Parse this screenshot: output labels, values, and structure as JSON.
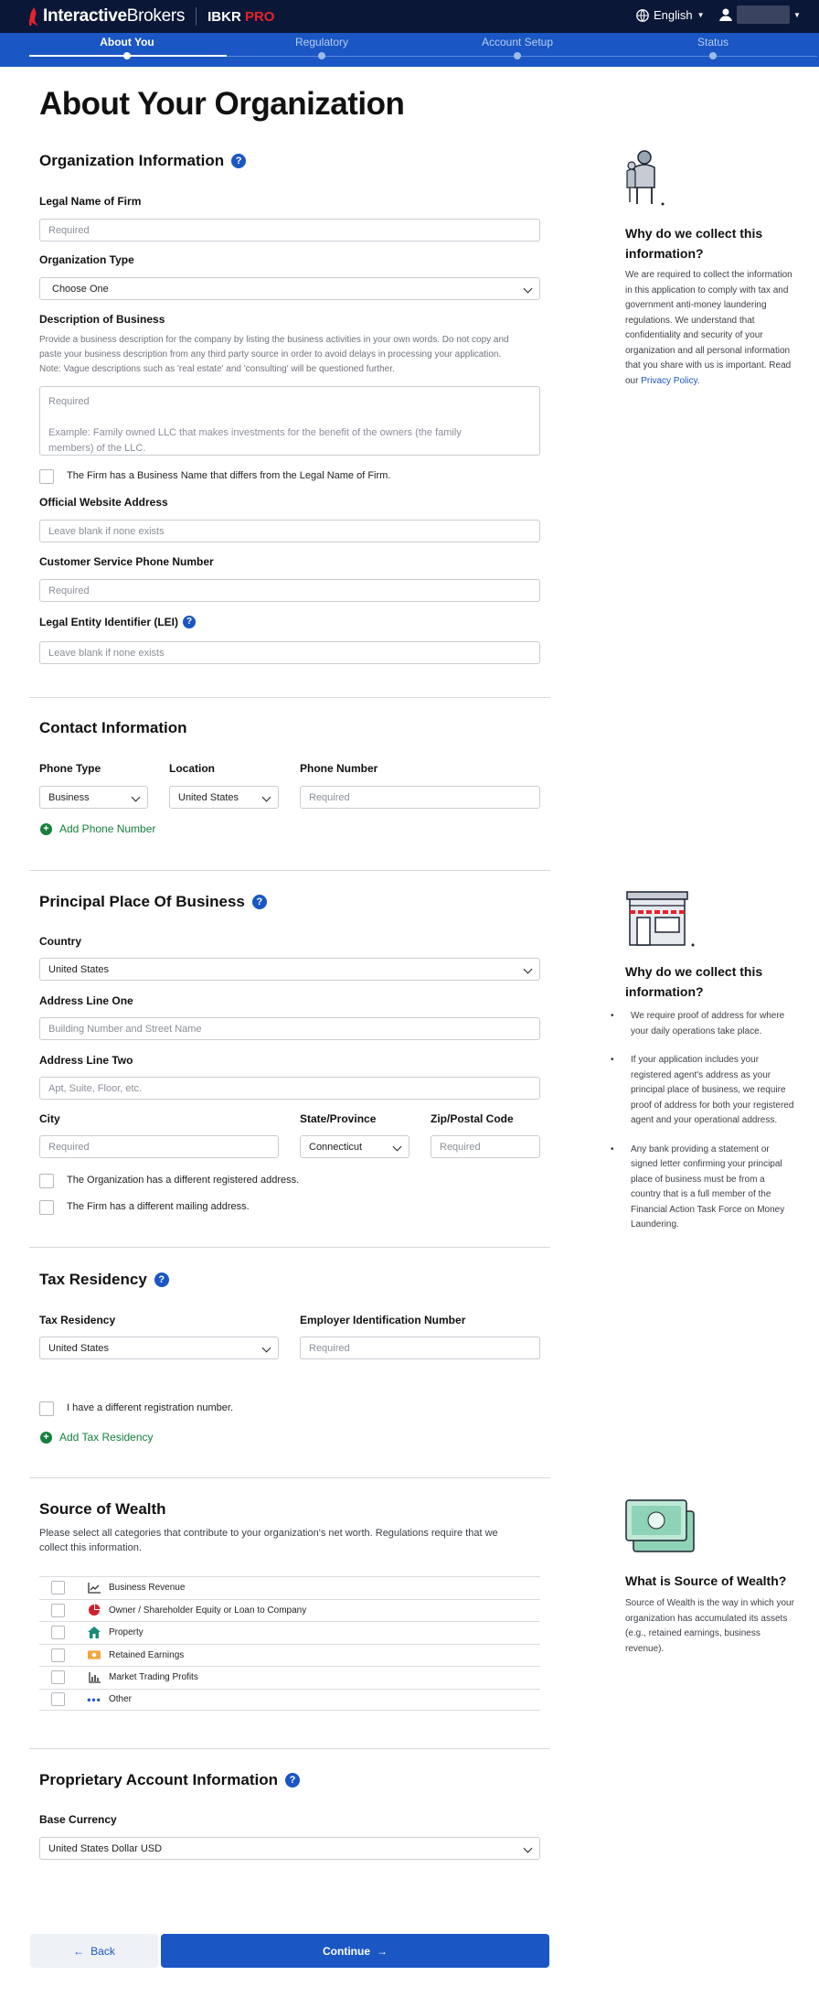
{
  "header": {
    "brand": "InteractiveBrokers",
    "brand_bold": "Interactive",
    "brand_light": "Brokers",
    "product_prefix": "IBKR",
    "product_suffix": "PRO",
    "language": "English",
    "colors": {
      "topbar": "#0b1736",
      "progress": "#1a56c4",
      "accent_red": "#e4232d"
    }
  },
  "steps": [
    {
      "label": "About You",
      "active": true
    },
    {
      "label": "Regulatory",
      "active": false
    },
    {
      "label": "Account Setup",
      "active": false
    },
    {
      "label": "Status",
      "active": false
    }
  ],
  "page_title": "About Your Organization",
  "org_info": {
    "title": "Organization Information",
    "legal_name_label": "Legal Name of Firm",
    "legal_name_placeholder": "Required",
    "org_type_label": "Organization Type",
    "org_type_value": "Choose One",
    "desc_label": "Description of Business",
    "desc_hint_1": "Provide a business description for the company by listing the business activities in your own words. Do not copy and",
    "desc_hint_2": "paste your business description from any third party source in order to avoid delays in processing your application.",
    "desc_hint_3": "Note: Vague descriptions such as 'real estate' and 'consulting' will be questioned further.",
    "desc_placeholder_1": "Required",
    "desc_placeholder_2": "Example: Family owned LLC that makes investments for the benefit of the owners (the family",
    "desc_placeholder_3": "members) of the LLC.",
    "business_name_check": "The Firm has a Business Name that differs from the Legal Name of Firm.",
    "website_label": "Official Website Address",
    "website_placeholder": "Leave blank if none exists",
    "phone_label": "Customer Service Phone Number",
    "phone_placeholder": "Required",
    "lei_label": "Legal Entity Identifier (LEI)",
    "lei_placeholder": "Leave blank if none exists"
  },
  "why_collect": {
    "title_1": "Why do we collect this",
    "title_2": "information?",
    "text_1": "We are required to collect the information",
    "text_2": "in this application to comply with tax and",
    "text_3": "government anti-money laundering",
    "text_4": "regulations. We understand that",
    "text_5": "confidentiality and security of your",
    "text_6": "organization and all personal information",
    "text_7": "that you share with us is important. Read",
    "text_8": "our",
    "privacy_link": "Privacy Policy",
    "text_9": "."
  },
  "contact": {
    "title": "Contact Information",
    "phone_type_label": "Phone Type",
    "phone_type_value": "Business",
    "location_label": "Location",
    "location_value": "United States",
    "phone_number_label": "Phone Number",
    "phone_number_placeholder": "Required",
    "add_phone": "Add Phone Number"
  },
  "principal": {
    "title": "Principal Place Of Business",
    "country_label": "Country",
    "country_value": "United States",
    "addr1_label": "Address Line One",
    "addr1_placeholder": "Building Number and Street Name",
    "addr2_label": "Address Line Two",
    "addr2_placeholder": "Apt, Suite, Floor, etc.",
    "city_label": "City",
    "city_placeholder": "Required",
    "state_label": "State/Province",
    "state_value": "Connecticut",
    "zip_label": "Zip/Postal Code",
    "zip_placeholder": "Required",
    "registered_check": "The Organization has a different registered address.",
    "mailing_check": "The Firm has a different mailing address."
  },
  "why_collect_2": {
    "title_1": "Why do we collect this",
    "title_2": "information?",
    "bullet_1": [
      "We require proof of address for where",
      "your daily operations take place."
    ],
    "bullet_2": [
      "If your application includes your",
      "registered agent's address as your",
      "principal place of business, we require",
      "proof of address for both your registered",
      "agent and your operational address."
    ],
    "bullet_3": [
      "Any bank providing a statement or",
      "signed letter confirming your principal",
      "place of business must be from a",
      "country that is a full member of the",
      "Financial Action Task Force on Money",
      "Laundering."
    ]
  },
  "tax": {
    "title": "Tax Residency",
    "residency_label": "Tax Residency",
    "residency_value": "United States",
    "ein_label": "Employer Identification Number",
    "ein_placeholder": "Required",
    "diff_reg_check": "I have a different registration number.",
    "add_tax": "Add Tax Residency"
  },
  "sow": {
    "title": "Source of Wealth",
    "desc_1": "Please select all categories that contribute to your organization's net worth. Regulations require that we",
    "desc_2": "collect this information.",
    "items": [
      {
        "label": "Business Revenue",
        "icon": "line-chart-icon"
      },
      {
        "label": "Owner / Shareholder Equity or Loan to Company",
        "icon": "pie-chart-icon"
      },
      {
        "label": "Property",
        "icon": "house-icon"
      },
      {
        "label": "Retained Earnings",
        "icon": "cash-icon"
      },
      {
        "label": "Market Trading Profits",
        "icon": "bar-chart-icon"
      },
      {
        "label": "Other",
        "icon": "more-dots-icon"
      }
    ]
  },
  "sow_side": {
    "title": "What is Source of Wealth?",
    "text_1": "Source of Wealth is the way in which your",
    "text_2": "organization has accumulated its assets",
    "text_3": "(e.g., retained earnings, business",
    "text_4": "revenue)."
  },
  "proprietary": {
    "title": "Proprietary Account Information",
    "currency_label": "Base Currency",
    "currency_value": "United States Dollar USD"
  },
  "footer": {
    "back": "Back",
    "continue": "Continue"
  }
}
